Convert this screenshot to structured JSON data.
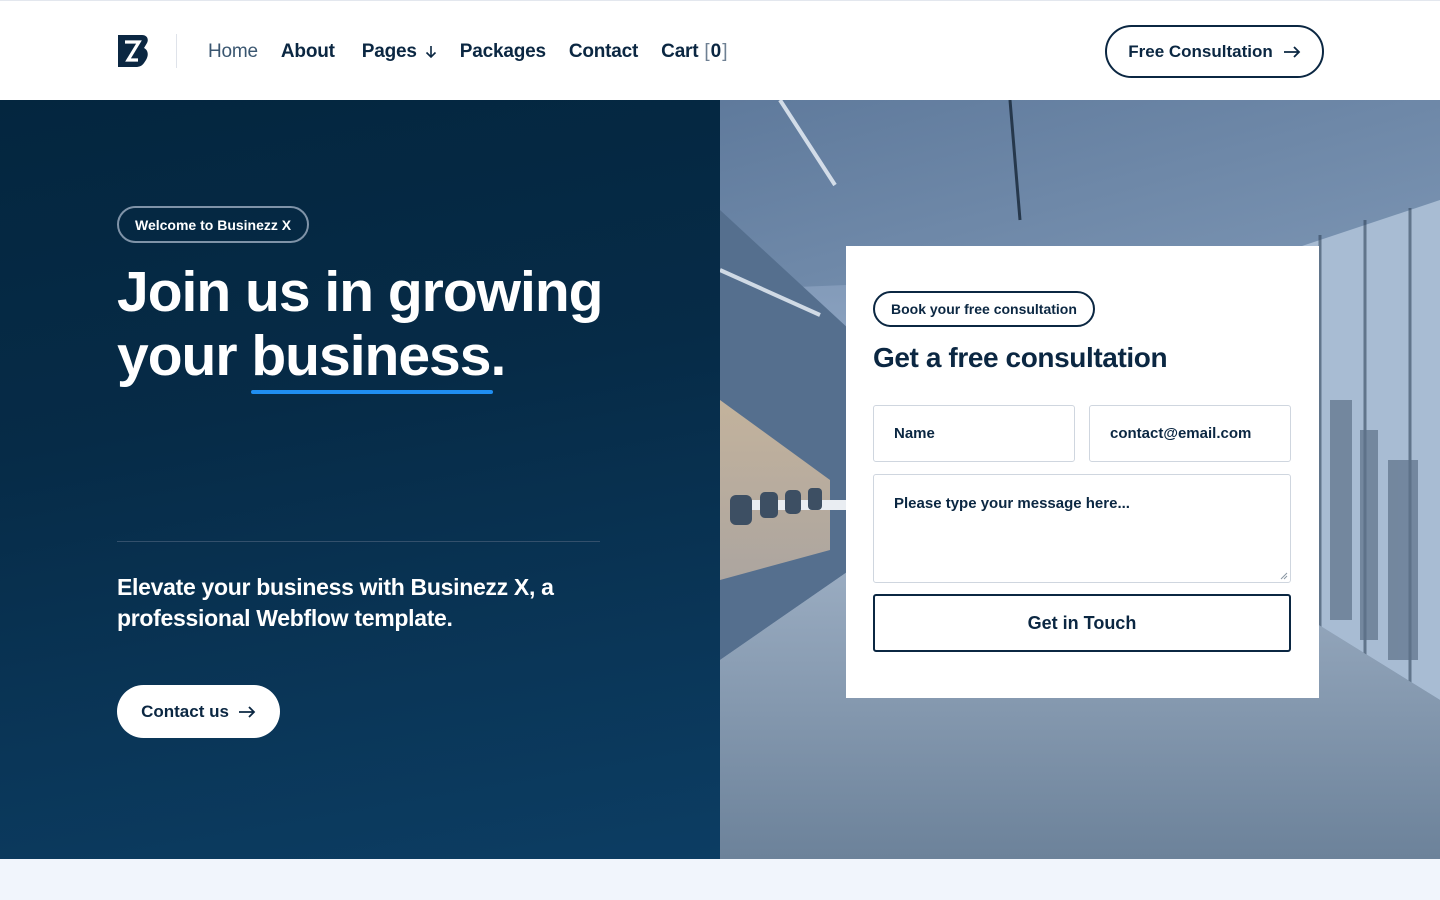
{
  "header": {
    "nav": [
      {
        "label": "Home",
        "active": true
      },
      {
        "label": "About"
      },
      {
        "label": "Pages",
        "has_dropdown": true
      },
      {
        "label": "Packages"
      },
      {
        "label": "Contact"
      },
      {
        "label": "Cart"
      }
    ],
    "cart_count": "0",
    "cta_label": "Free Consultation"
  },
  "hero": {
    "pill": "Welcome to Businezz X",
    "title_line1": "Join us in growing",
    "title_line2_prefix": "your ",
    "title_line2_highlight": "business",
    "title_line2_suffix": ".",
    "subtitle": "Elevate your business with Businezz X, a professional Webflow template.",
    "contact_label": "Contact us"
  },
  "form": {
    "pill": "Book your free consultation",
    "title": "Get a free consultation",
    "name_placeholder": "Name",
    "email_placeholder": "contact@email.com",
    "message_placeholder": "Please type your message here...",
    "submit_label": "Get in Touch"
  },
  "colors": {
    "navy": "#0b2742",
    "hero_bg": "#062b47",
    "accent_blue": "#1f8ef1",
    "page_bg": "#f1f5fc"
  }
}
